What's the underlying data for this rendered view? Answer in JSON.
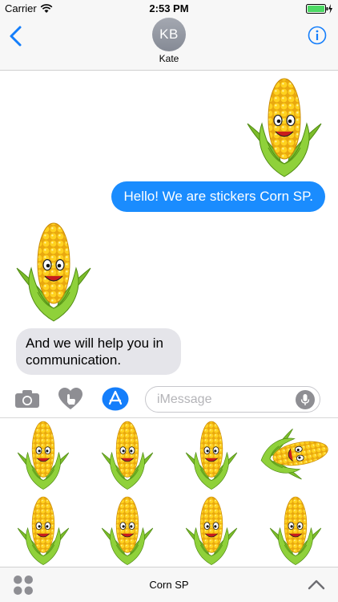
{
  "status_bar": {
    "carrier": "Carrier",
    "time": "2:53 PM"
  },
  "header": {
    "avatar_initials": "KB",
    "contact_name": "Kate"
  },
  "messages": [
    {
      "type": "sticker",
      "direction": "outgoing",
      "sticker": "corn-winking-grin"
    },
    {
      "type": "text",
      "direction": "outgoing",
      "text": "Hello! We are stickers Corn SP."
    },
    {
      "type": "sticker",
      "direction": "incoming",
      "sticker": "corn-wink-smile"
    },
    {
      "type": "text",
      "direction": "incoming",
      "text": "And we will help you in communication."
    }
  ],
  "input": {
    "placeholder": "iMessage"
  },
  "drawer": {
    "stickers": [
      "corn-sleepy",
      "corn-dizzy",
      "corn-laughing",
      "corn-lying",
      "corn-wink",
      "corn-crying",
      "corn-surprised",
      "corn-worried"
    ]
  },
  "bottom_bar": {
    "app_name": "Corn SP"
  },
  "colors": {
    "accent": "#147efb",
    "bubble_out": "#1a8cfe",
    "bubble_in": "#e5e5ea",
    "battery": "#4cd964"
  }
}
